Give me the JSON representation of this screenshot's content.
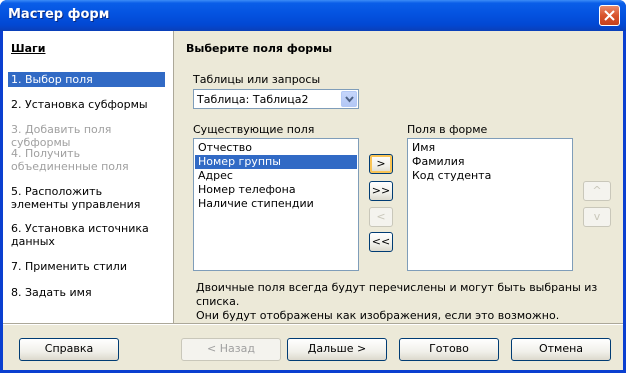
{
  "window": {
    "title": "Мастер форм"
  },
  "sidebar": {
    "title": "Шаги",
    "steps": [
      {
        "label": "1.  Выбор поля"
      },
      {
        "label": "2.  Установка субформы"
      },
      {
        "label": "3.  Добавить поля субформы"
      },
      {
        "label": "4.  Получить объединенные поля"
      },
      {
        "label": "5.  Расположить элементы управления"
      },
      {
        "label": "6.  Установка источника данных"
      },
      {
        "label": "7.  Применить стили"
      },
      {
        "label": "8.  Задать имя"
      }
    ]
  },
  "main": {
    "title": "Выберите поля формы",
    "tables_label": "Таблицы или запросы",
    "tables_selected": "Таблица: Таблица2",
    "existing_label": "Существующие поля",
    "existing_fields": [
      "Отчество",
      "Номер группы",
      "Адрес",
      "Номер телефона",
      "Наличие стипендии"
    ],
    "selected_existing": "Номер группы",
    "form_label": "Поля в форме",
    "form_fields": [
      "Имя",
      "Фамилия",
      "Код студента"
    ],
    "move_buttons": {
      "add": ">",
      "add_all": ">>",
      "remove": "<",
      "remove_all": "<<"
    },
    "order_buttons": {
      "up": "^",
      "down": "v"
    },
    "info_line1": "Двоичные поля всегда будут перечислены и могут быть выбраны из списка.",
    "info_line2": "Они будут отображены как изображения, если это возможно."
  },
  "buttons": {
    "help": "Справка",
    "back": "< Назад",
    "next": "Дальше >",
    "finish": "Готово",
    "cancel": "Отмена"
  },
  "colors": {
    "selection": "#316ac5",
    "dialog_bg": "#ece9d8",
    "titlebar": "#0453e0"
  }
}
